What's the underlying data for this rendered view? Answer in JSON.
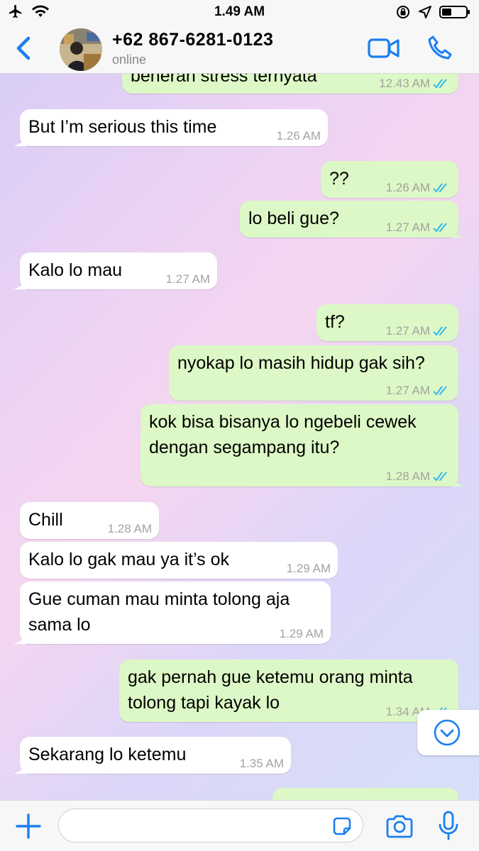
{
  "status_bar": {
    "time": "1.49 AM"
  },
  "header": {
    "contact_name": "+62 867-6281-0123",
    "contact_status": "online"
  },
  "messages": [
    {
      "dir": "out",
      "text": "beneran stress ternyata",
      "time": "12.43 AM",
      "read": true
    },
    {
      "dir": "in",
      "text": "But I’m serious this time",
      "time": "1.26 AM"
    },
    {
      "dir": "out",
      "text": "??",
      "time": "1.26 AM",
      "read": true
    },
    {
      "dir": "out",
      "text": "lo beli gue?",
      "time": "1.27 AM",
      "read": true
    },
    {
      "dir": "in",
      "text": "Kalo lo mau",
      "time": "1.27 AM"
    },
    {
      "dir": "out",
      "text": "tf?",
      "time": "1.27 AM",
      "read": true
    },
    {
      "dir": "out",
      "text": "nyokap lo masih hidup gak sih?",
      "time": "1.27 AM",
      "read": true
    },
    {
      "dir": "out",
      "text_lines": [
        "kok bisa bisanya lo ngebeli cewek",
        "dengan segampang itu?"
      ],
      "time": "1.28 AM",
      "read": true
    },
    {
      "dir": "in",
      "text": "Chill",
      "time": "1.28 AM"
    },
    {
      "dir": "in",
      "text": "Kalo lo gak mau ya it’s ok",
      "time": "1.29 AM"
    },
    {
      "dir": "in",
      "text_lines": [
        "Gue cuman mau minta tolong aja",
        "sama lo"
      ],
      "time": "1.29 AM"
    },
    {
      "dir": "out",
      "text_lines": [
        "gak pernah gue ketemu orang minta",
        "tolong tapi kayak lo"
      ],
      "time": "1.34 AM",
      "read": true
    },
    {
      "dir": "in",
      "text": "Sekarang lo ketemu",
      "time": "1.35 AM"
    }
  ],
  "input": {
    "placeholder": ""
  },
  "colors": {
    "accent": "#1a7ff0",
    "outgoing_bubble": "#dcf8c6",
    "incoming_bubble": "#ffffff",
    "read_ticks": "#34b7f1"
  },
  "icons": {
    "status_left": [
      "airplane-icon",
      "wifi-icon"
    ],
    "status_right": [
      "orientation-lock-icon",
      "location-arrow-icon",
      "battery-icon"
    ],
    "header": [
      "back-chevron-icon",
      "video-call-icon",
      "phone-icon"
    ],
    "input_bar": [
      "plus-icon",
      "sticker-icon",
      "camera-icon",
      "mic-icon"
    ],
    "scroll": "chevron-down-circle-icon"
  }
}
